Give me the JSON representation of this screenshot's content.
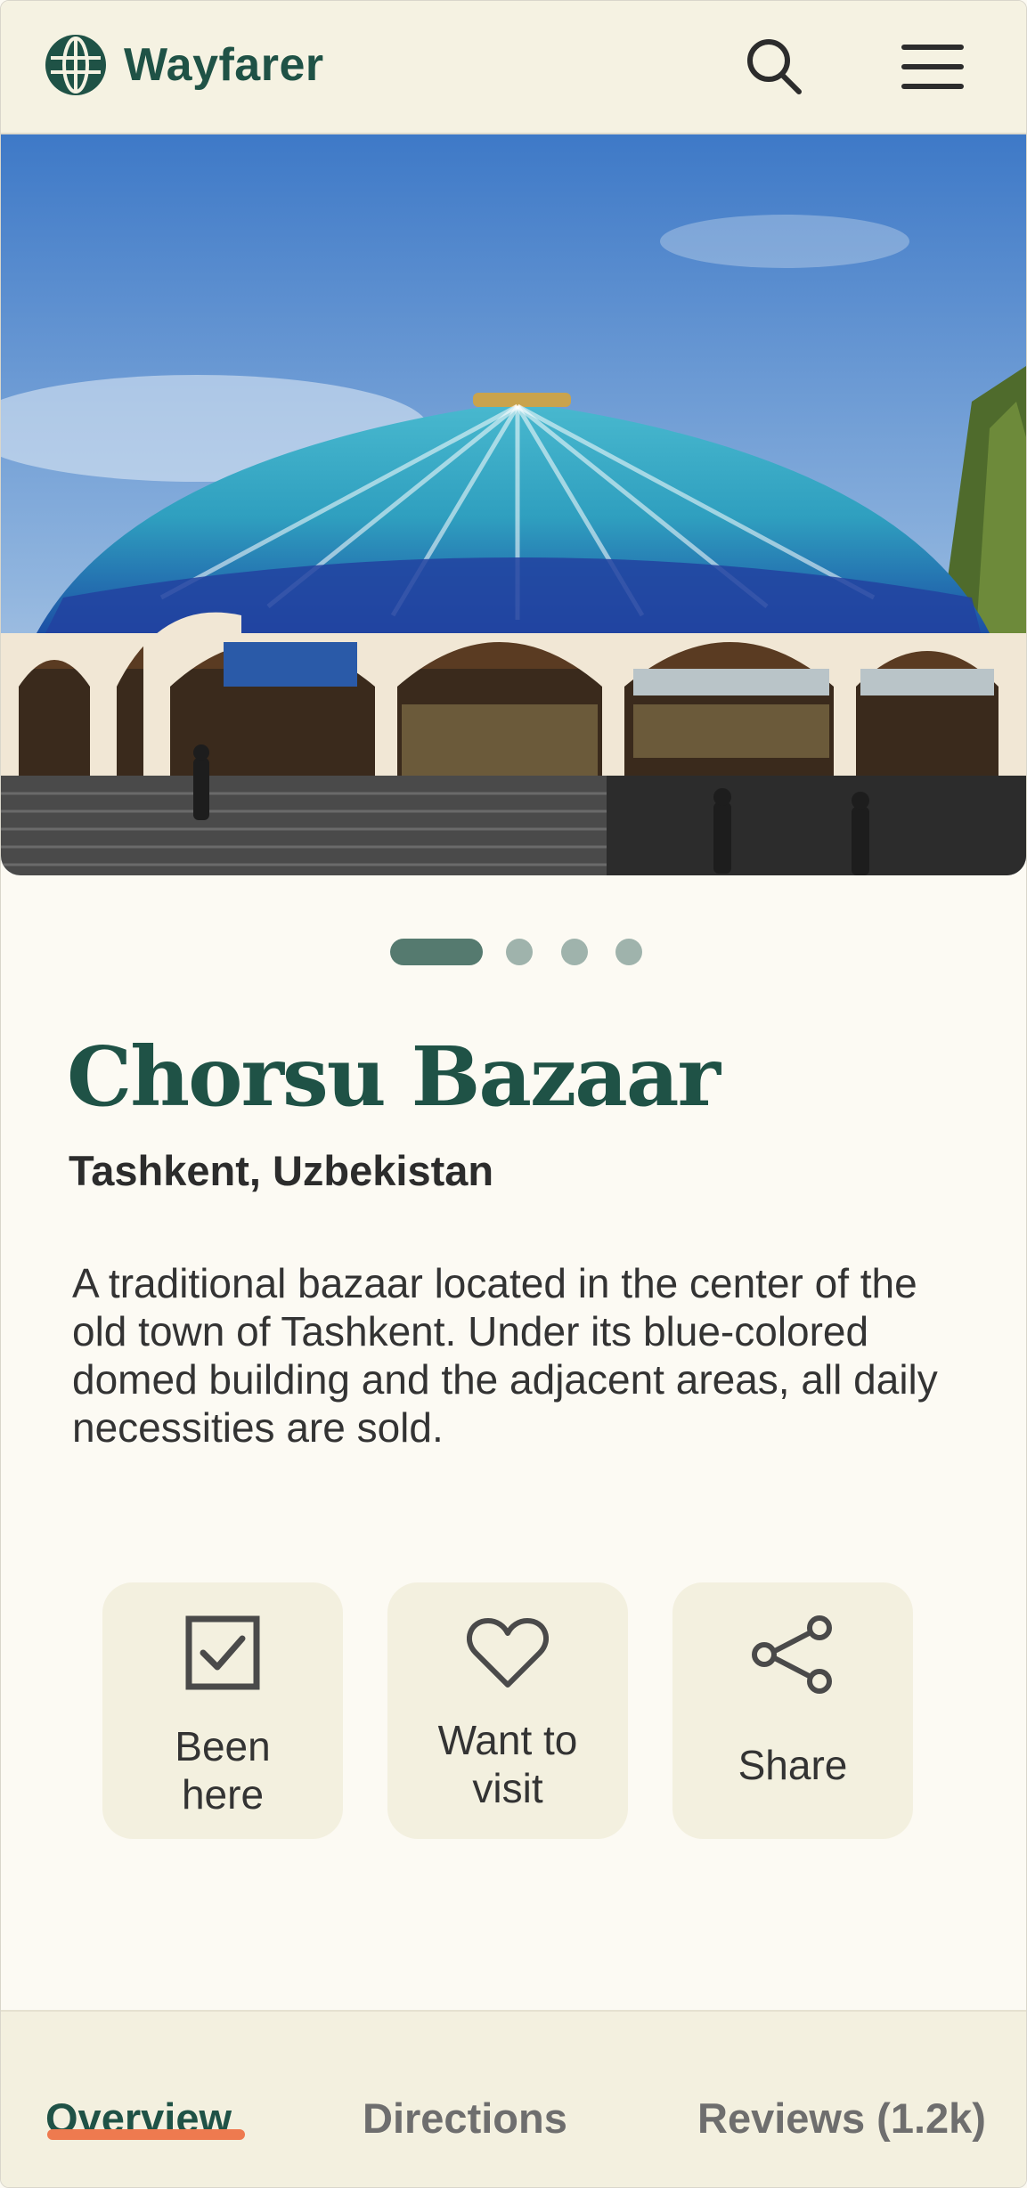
{
  "app": {
    "name": "Wayfarer",
    "logo_icon": "globe-icon",
    "brand_color": "#1f5246",
    "accent_color": "#ee7a4f"
  },
  "header": {
    "search_icon": "search-icon",
    "menu_icon": "hamburger-menu-icon"
  },
  "carousel": {
    "total_slides": 4,
    "active_index": 0
  },
  "place": {
    "name": "Chorsu Bazaar",
    "location": "Tashkent, Uzbekistan",
    "description": "A traditional bazaar located in the center of the old town of Tashkent. Under its blue-colored domed building and the adjacent areas, all daily necessities are sold."
  },
  "actions": [
    {
      "icon": "checkbox-icon",
      "line1": "Been",
      "line2": "here"
    },
    {
      "icon": "heart-icon",
      "line1": "Want to",
      "line2": "visit"
    },
    {
      "icon": "share-icon",
      "label": "Share"
    }
  ],
  "tabs": [
    {
      "label": "Overview",
      "active": true
    },
    {
      "label": "Directions",
      "active": false
    },
    {
      "label": "Reviews (1.2k)",
      "active": false
    }
  ]
}
